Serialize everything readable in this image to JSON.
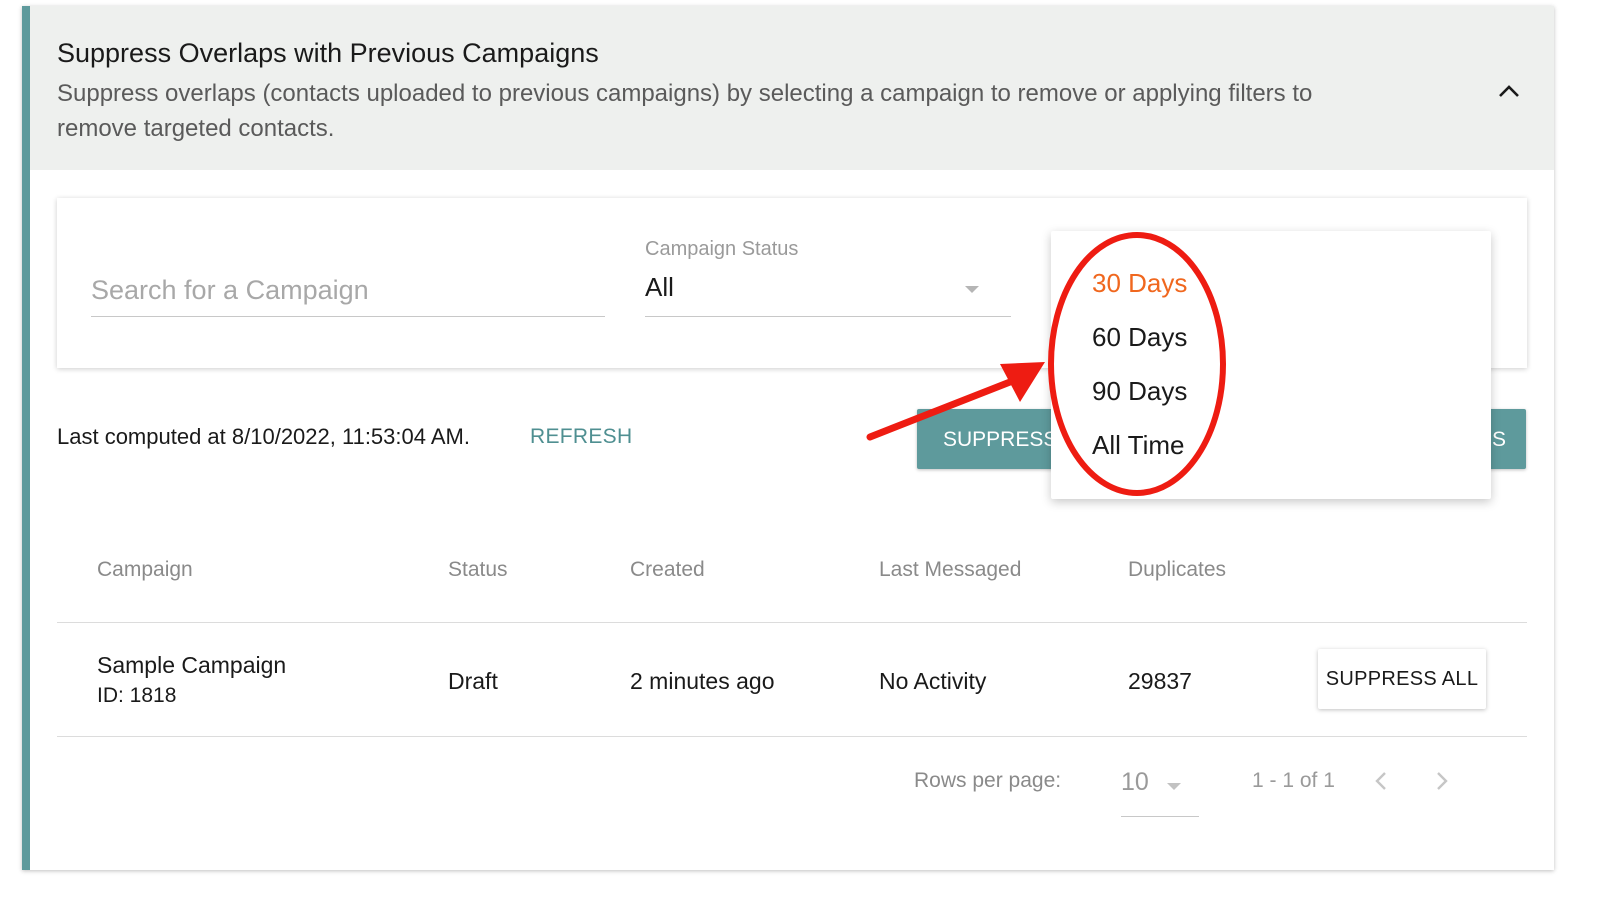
{
  "header": {
    "title": "Suppress Overlaps with Previous Campaigns",
    "description": "Suppress overlaps (contacts uploaded to previous campaigns) by selecting a campaign to remove or applying filters to remove targeted contacts."
  },
  "filters": {
    "search_placeholder": "Search for a Campaign",
    "status_label": "Campaign Status",
    "status_value": "All"
  },
  "dropdown": {
    "options": [
      {
        "label": "30 Days",
        "selected": true
      },
      {
        "label": "60 Days",
        "selected": false
      },
      {
        "label": "90 Days",
        "selected": false
      },
      {
        "label": "All Time",
        "selected": false
      }
    ]
  },
  "toolbar": {
    "last_computed": "Last computed at 8/10/2022, 11:53:04 AM.",
    "refresh_label": "REFRESH",
    "suppress_label": "SUPPRESS",
    "suppress_label_end": "S"
  },
  "table": {
    "columns": [
      "Campaign",
      "Status",
      "Created",
      "Last Messaged",
      "Duplicates"
    ],
    "rows": [
      {
        "campaign": "Sample Campaign",
        "campaign_id": "ID: 1818",
        "status": "Draft",
        "created": "2 minutes ago",
        "last_messaged": "No Activity",
        "duplicates": "29837",
        "action_label": "SUPPRESS ALL"
      }
    ]
  },
  "pagination": {
    "rows_per_page_label": "Rows per page:",
    "rows_per_page": "10",
    "range": "1 - 1 of 1"
  },
  "colors": {
    "accent": "#5e9a9c",
    "selected_option": "#f0671e",
    "annotation": "#ee1c12"
  },
  "icons": [
    "chevron-up-icon",
    "caret-down-icon",
    "chevron-left-icon",
    "chevron-right-icon"
  ]
}
